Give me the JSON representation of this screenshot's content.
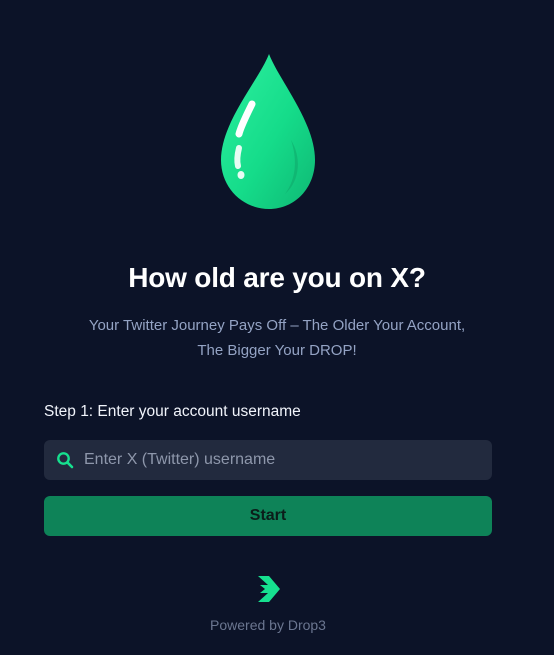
{
  "hero": {
    "icon": "water-drop-icon",
    "title": "How old are you on X?",
    "subtitle_line1": "Your Twitter Journey Pays Off – The Older Your Account,",
    "subtitle_line2": "The Bigger Your DROP!"
  },
  "form": {
    "step_label": "Step 1: Enter your account username",
    "search_icon": "search-icon",
    "username_placeholder": "Enter X (Twitter) username",
    "username_value": "",
    "start_label": "Start"
  },
  "footer": {
    "logo_icon": "drop3-logo-icon",
    "powered_by": "Powered by Drop3"
  },
  "colors": {
    "background": "#0c1328",
    "accent": "#16e08f",
    "button": "#0e8358",
    "input_bg": "#222a3e",
    "subtitle_text": "#94a3c4"
  }
}
